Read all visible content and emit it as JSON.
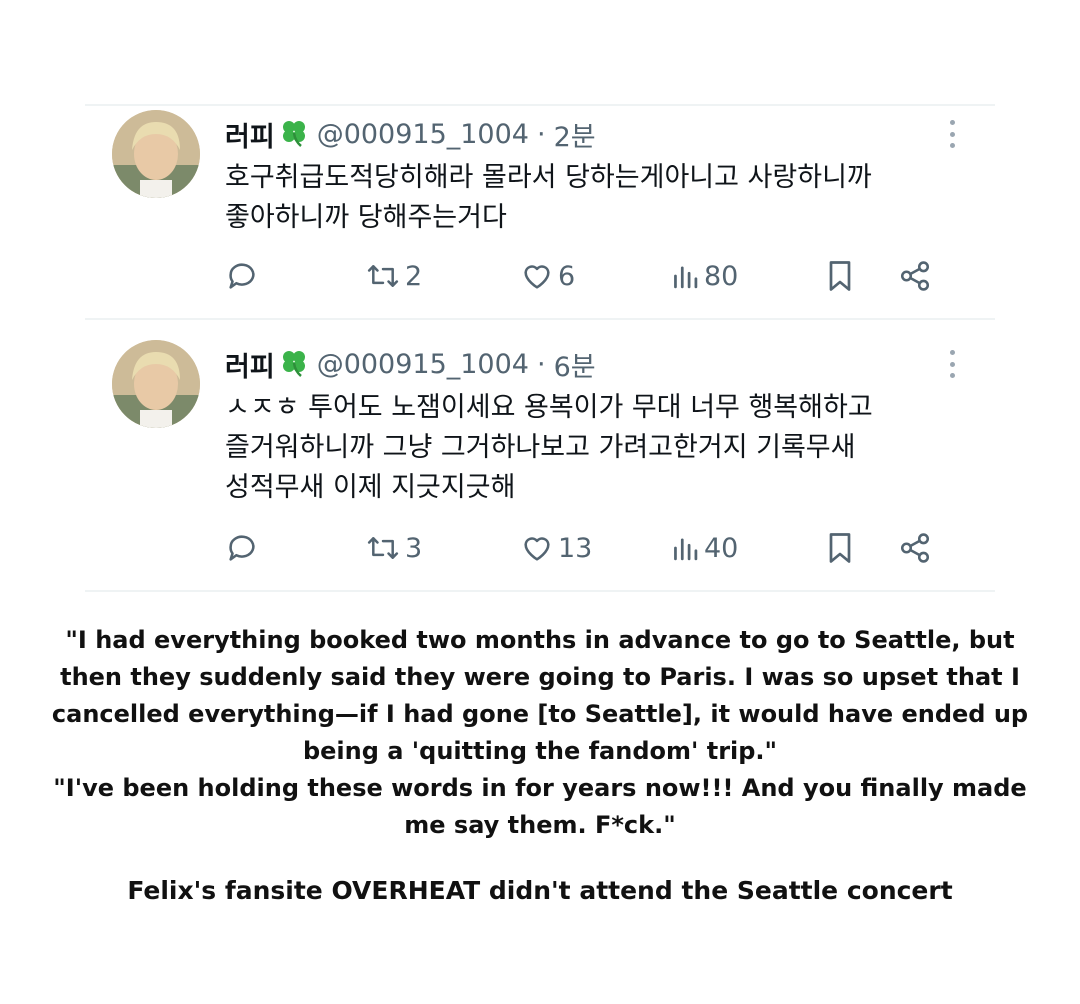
{
  "tweets": [
    {
      "display_name": "러피",
      "handle": "@000915_1004",
      "separator": "·",
      "time": "2분",
      "text_lines": [
        "호구취급도적당히해라 몰라서 당하는게아니고 사랑하니까",
        "좋아하니까 당해주는거다"
      ],
      "retweets": "2",
      "likes": "6",
      "views": "80"
    },
    {
      "display_name": "러피",
      "handle": "@000915_1004",
      "separator": "·",
      "time": "6분",
      "text_lines": [
        "ㅅㅈㅎ 투어도 노잼이세요 용복이가 무대 너무 행복해하고",
        "즐거워하니까 그냥 그거하나보고 가려고한거지 기록무새",
        "성적무새 이제 지긋지긋해"
      ],
      "retweets": "3",
      "likes": "13",
      "views": "40"
    }
  ],
  "caption_lines": [
    "\"I had everything booked two months in advance to go to Seattle, but",
    "then they suddenly said they were going to Paris. I was so upset that I",
    "cancelled everything—if I had gone [to Seattle], it would have ended up",
    "being a 'quitting the fandom' trip.\"",
    "\"I've been holding these words in for years now!!! And you finally made",
    "me say them. F*ck.\""
  ],
  "footer": "Felix's fansite OVERHEAT didn't attend the Seattle concert",
  "colors": {
    "text": "#0f1419",
    "secondary": "#536471",
    "divider": "#eff3f4",
    "clover": "#3bb34a"
  },
  "icons": [
    "clover-icon",
    "more-icon",
    "reply-icon",
    "retweet-icon",
    "like-icon",
    "views-icon",
    "bookmark-icon",
    "share-icon"
  ]
}
